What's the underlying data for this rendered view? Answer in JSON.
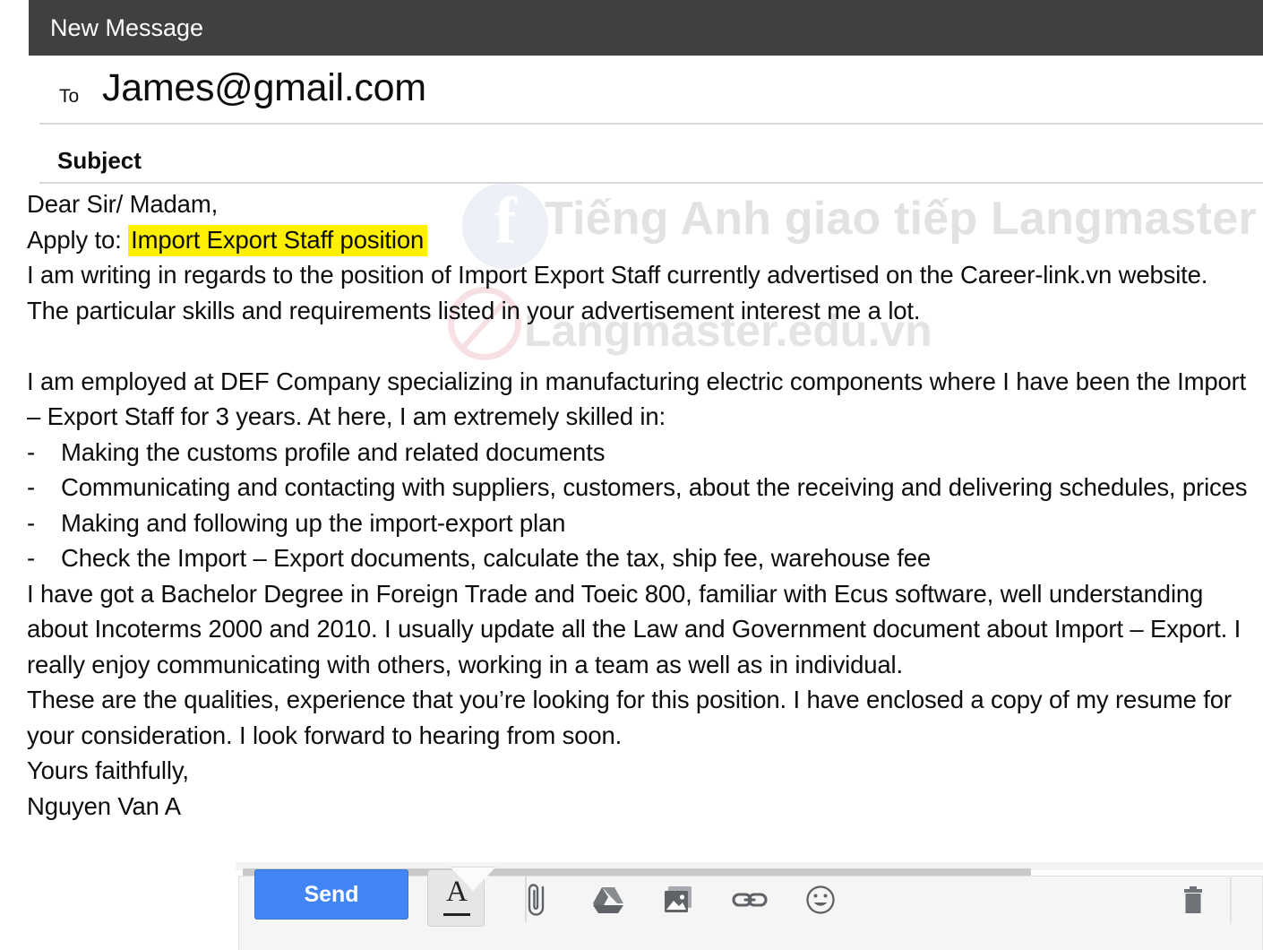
{
  "window": {
    "title": "New Message"
  },
  "fields": {
    "to_label": "To",
    "to_value": "James@gmail.com",
    "subject_label": "Subject",
    "subject_value": ""
  },
  "body": {
    "salutation": "Dear Sir/ Madam,",
    "apply_prefix": "Apply to:",
    "apply_highlight": "Import Export Staff position",
    "highlight_color": "#ffef00",
    "paragraph_1": "I am writing in regards to the position of Import Export Staff currently advertised on the Career-link.vn website. The particular skills and requirements listed in your advertisement interest me a lot.",
    "paragraph_2": "I am employed at DEF Company specializing in manufacturing electric components where I have been the Import – Export Staff for 3 years. At here, I am extremely skilled in:",
    "bullets": [
      "Making the customs profile and related documents",
      "Communicating and contacting with suppliers, customers, about the receiving and delivering schedules, prices",
      "Making and following up the import-export plan",
      "Check the Import – Export documents, calculate the tax, ship fee, warehouse fee"
    ],
    "paragraph_3": "I have got a Bachelor Degree in Foreign Trade and Toeic 800, familiar with Ecus software, well understanding about Incoterms 2000 and 2010. I usually update all the Law and Government document about Import – Export. I really enjoy communicating with others, working in a team as well as in individual.",
    "paragraph_4": "These are the qualities, experience that you’re looking for this position. I have enclosed a copy of my resume for your consideration. I look forward to hearing from soon.",
    "closing": "Yours faithfully,",
    "signature": "Nguyen Van A"
  },
  "toolbar": {
    "send_label": "Send",
    "format_glyph": "A",
    "icons": [
      {
        "name": "format-options-icon",
        "label": "Formatting options"
      },
      {
        "name": "attach-file-icon",
        "label": "Attach files"
      },
      {
        "name": "google-drive-icon",
        "label": "Insert files using Drive"
      },
      {
        "name": "insert-photo-icon",
        "label": "Insert photo"
      },
      {
        "name": "insert-link-icon",
        "label": "Insert link"
      },
      {
        "name": "insert-emoji-icon",
        "label": "Insert emoji"
      },
      {
        "name": "discard-draft-icon",
        "label": "Discard draft"
      }
    ],
    "accent_color": "#4285f4"
  },
  "watermark": {
    "line1": "Tiếng Anh giao tiếp Langmaster",
    "line2": "Langmaster.edu.vn",
    "facebook_glyph": "f"
  }
}
